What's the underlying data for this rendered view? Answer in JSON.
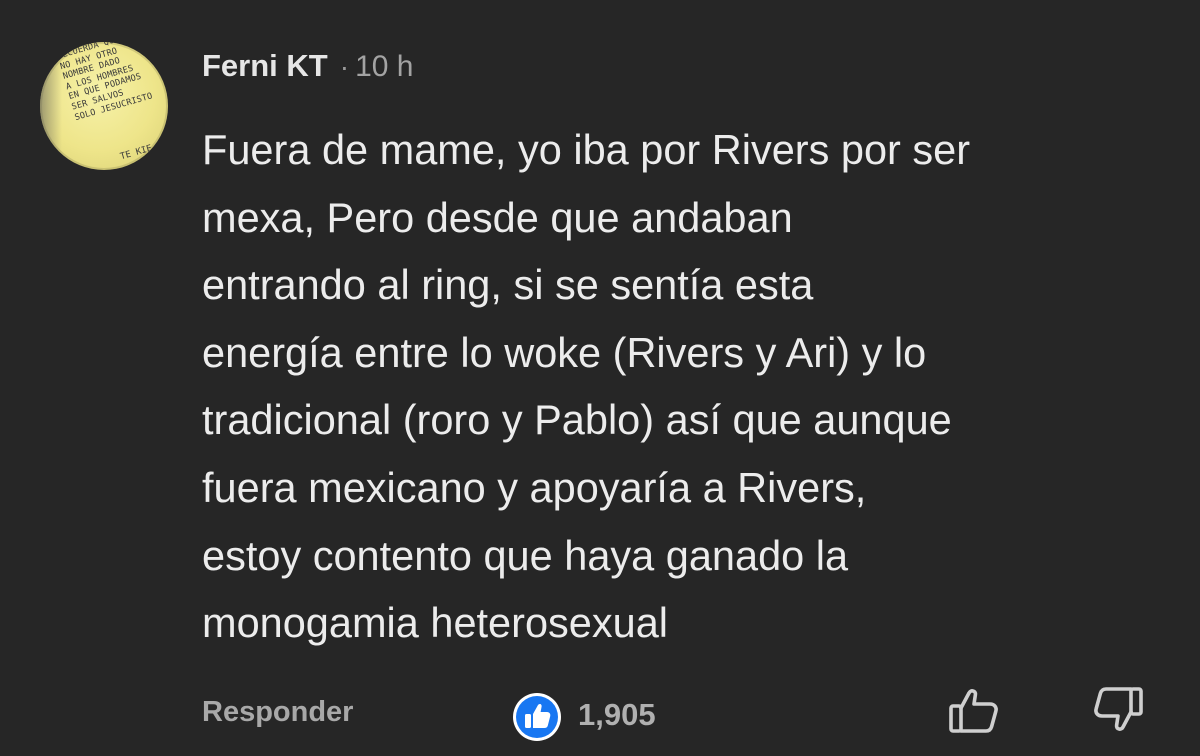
{
  "comment": {
    "author": "Ferni KT",
    "separator": "·",
    "time": "10 h",
    "avatar": {
      "note": "RECUERDA QUE\nNO HAY OTRO\nNOMBRE DADO\nA LOS HOMBRES\nEN QUE PODAMOS\nSER SALVOS\nSOLO JESUCRISTO",
      "sign": "TE KIE",
      "bg_color": "#eee58a"
    },
    "lines": [
      "Fuera de mame, yo iba por Rivers por ser",
      "mexa, Pero desde que andaban",
      "entrando al ring, si se sentía esta",
      "energía entre lo woke (Rivers y Ari) y lo",
      "tradicional (roro y Pablo) así que aunque",
      "fuera mexicano y apoyaría a Rivers,",
      "estoy contento que haya ganado la",
      "monogamia heterosexual"
    ]
  },
  "actions": {
    "reply_label": "Responder",
    "reaction_icon": "like-reaction-icon",
    "reaction_count": "1,905",
    "like_icon": "thumbs-up-outline-icon",
    "dislike_icon": "thumbs-down-outline-icon"
  },
  "colors": {
    "background": "#262626",
    "text": "#ececec",
    "muted": "#a8a8a8",
    "like_blue": "#1877f2"
  }
}
